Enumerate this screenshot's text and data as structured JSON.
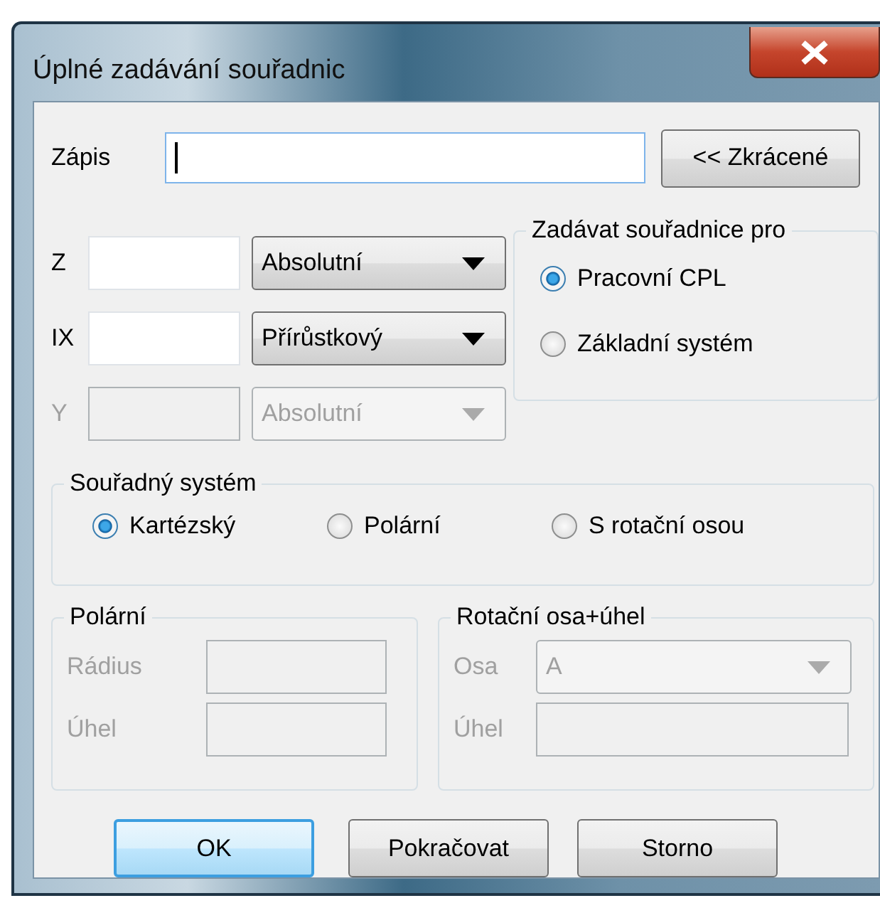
{
  "window": {
    "title": "Úplné zadávání souřadnic"
  },
  "entry": {
    "label": "Zápis",
    "focused": true
  },
  "shorten_button": {
    "label": "<< Zkrácené"
  },
  "axes": [
    {
      "label": "Z",
      "mode": "Absolutní",
      "disabled": false
    },
    {
      "label": "IX",
      "mode": "Přírůstkový",
      "disabled": false
    },
    {
      "label": "Y",
      "mode": "Absolutní",
      "disabled": true
    }
  ],
  "target_group": {
    "title": "Zadávat souřadnice pro",
    "options": [
      {
        "label": "Pracovní CPL",
        "selected": true
      },
      {
        "label": "Základní systém",
        "selected": false
      }
    ]
  },
  "system_group": {
    "title": "Souřadný systém",
    "options": [
      {
        "label": "Kartézský",
        "selected": true
      },
      {
        "label": "Polární",
        "selected": false
      },
      {
        "label": "S rotační osou",
        "selected": false
      }
    ]
  },
  "polar_group": {
    "title": "Polární",
    "disabled": true,
    "fields": [
      {
        "label": "Rádius"
      },
      {
        "label": "Úhel"
      }
    ]
  },
  "rotary_group": {
    "title": "Rotační osa+úhel",
    "disabled": true,
    "axis": {
      "label": "Osa",
      "value": "A"
    },
    "angle": {
      "label": "Úhel"
    }
  },
  "buttons": [
    {
      "label": "OK",
      "default": true
    },
    {
      "label": "Pokračovat",
      "default": false
    },
    {
      "label": "Storno",
      "default": false
    }
  ]
}
